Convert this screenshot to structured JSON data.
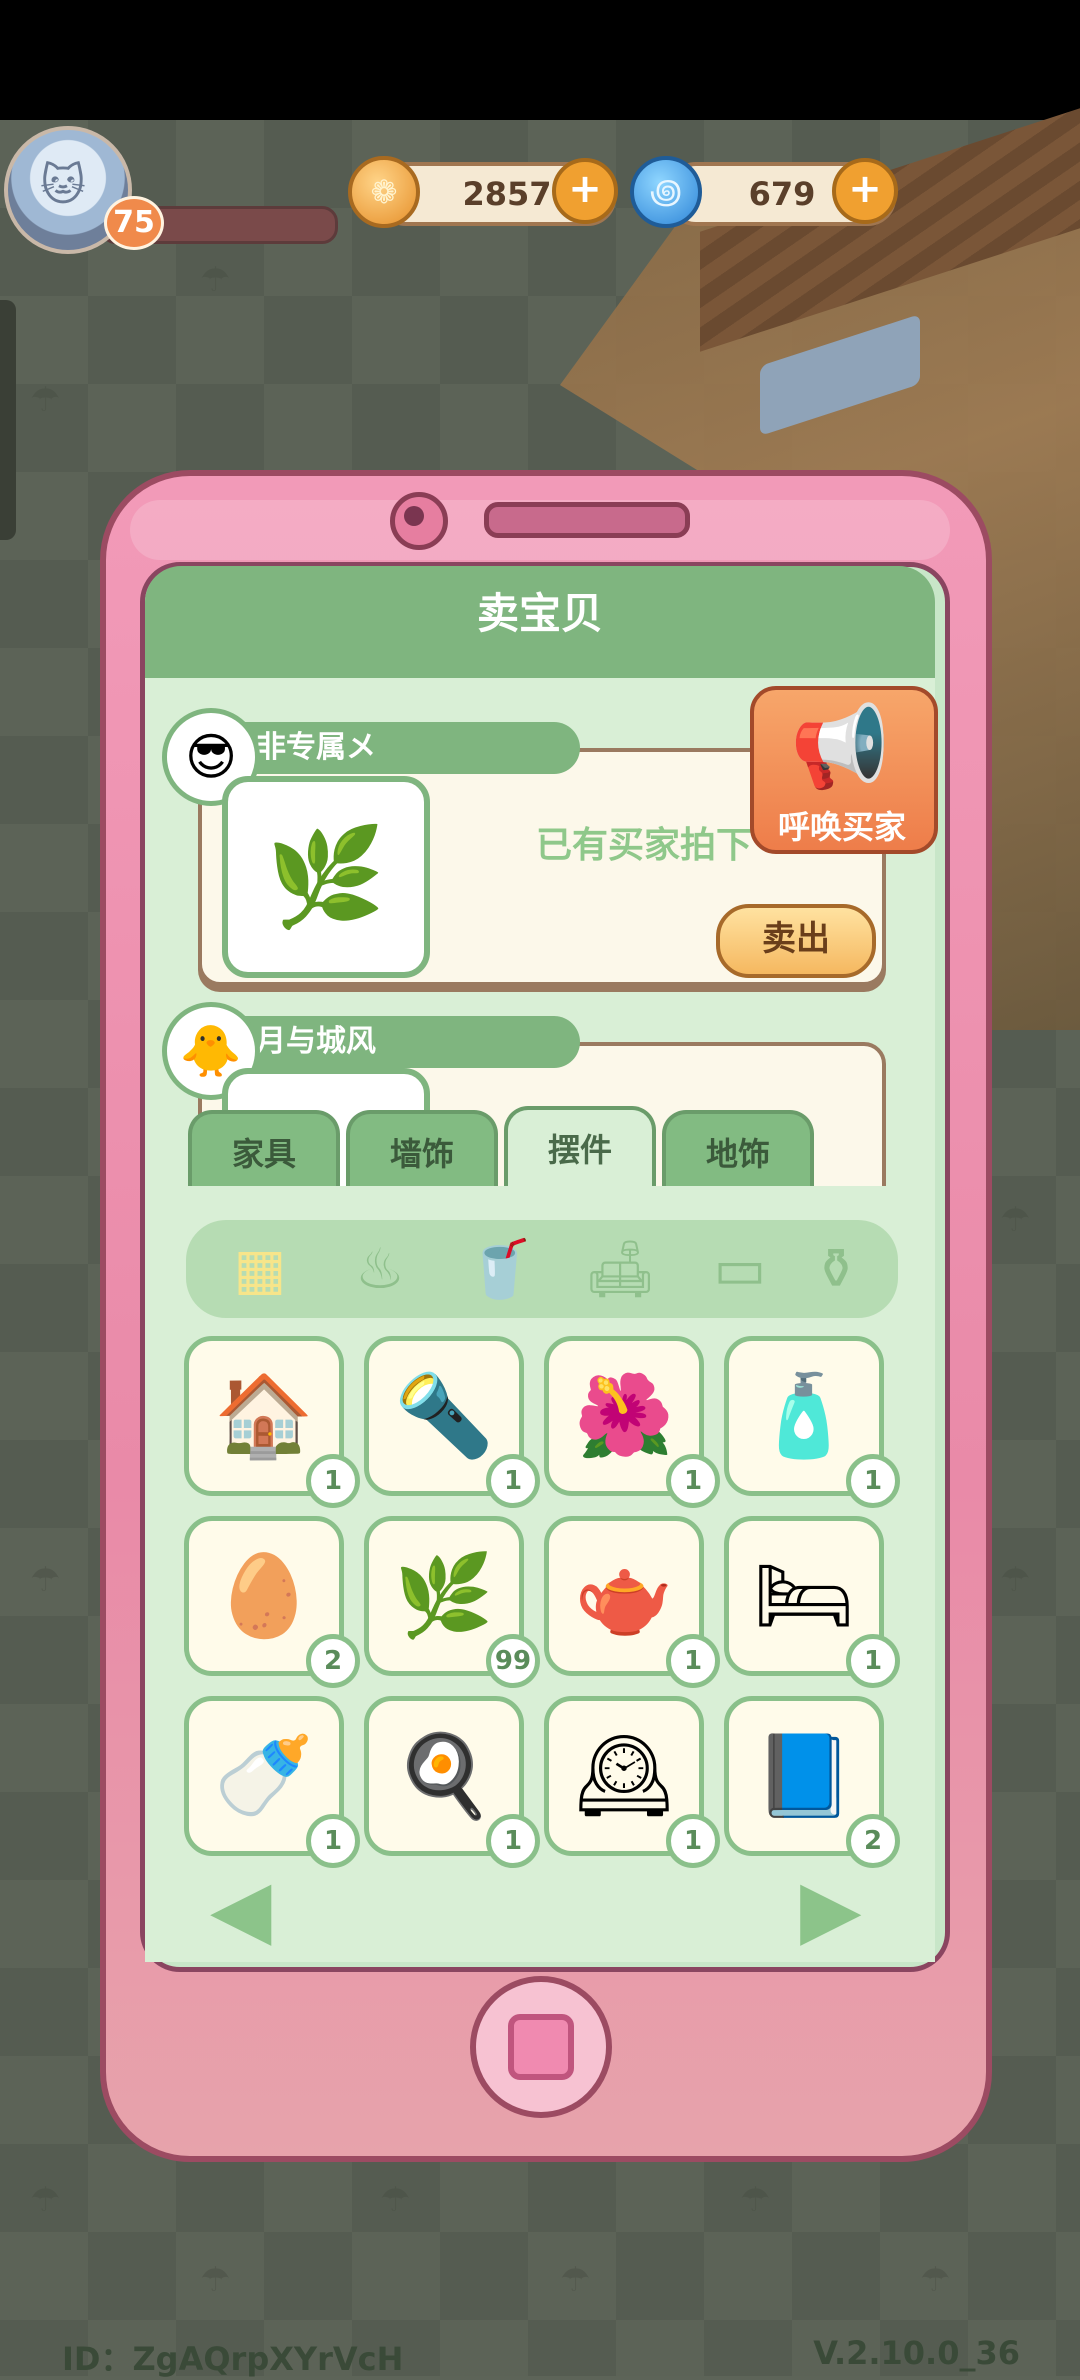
{
  "hud": {
    "level": "75",
    "coins": "2857",
    "gems": "679",
    "plus_label": "+"
  },
  "screen": {
    "title": "卖宝贝",
    "call_buyer_label": "呼唤买家"
  },
  "listings": [
    {
      "seller": "非专属メ",
      "status": "已有买家拍下",
      "sell_label": "卖出",
      "item_icon": "branch-coral-icon"
    },
    {
      "seller": "月与城风",
      "status": "",
      "sell_label": "",
      "item_icon": "branch-coral-icon"
    }
  ],
  "tabs": [
    {
      "label": "家具",
      "active": false
    },
    {
      "label": "墙饰",
      "active": false
    },
    {
      "label": "摆件",
      "active": true
    },
    {
      "label": "地饰",
      "active": false
    }
  ],
  "categories": [
    "grid-icon",
    "pot-icon",
    "cup-icon",
    "lamp-icon",
    "pillow-icon",
    "vase-icon"
  ],
  "inventory": [
    {
      "icon": "dollhouse-icon",
      "glyph": "🏠",
      "count": "1"
    },
    {
      "icon": "flashlight-icon",
      "glyph": "🔦",
      "count": "1"
    },
    {
      "icon": "flower-planter-icon",
      "glyph": "🌺",
      "count": "1"
    },
    {
      "icon": "tube-bottle-icon",
      "glyph": "🧴",
      "count": "1"
    },
    {
      "icon": "egg-icon",
      "glyph": "🥚",
      "count": "2"
    },
    {
      "icon": "branch-coral-icon",
      "glyph": "🌿",
      "count": "99"
    },
    {
      "icon": "tea-set-icon",
      "glyph": "🫖",
      "count": "1"
    },
    {
      "icon": "cushion-icon",
      "glyph": "🛏",
      "count": "1"
    },
    {
      "icon": "soda-bottle-icon",
      "glyph": "🍼",
      "count": "1"
    },
    {
      "icon": "grill-pan-icon",
      "glyph": "🍳",
      "count": "1"
    },
    {
      "icon": "grandfather-clock-icon",
      "glyph": "🕰",
      "count": "1"
    },
    {
      "icon": "book-icon",
      "glyph": "📘",
      "count": "2"
    }
  ],
  "footer": {
    "id": "ID：ZgAQrpXYrVcH",
    "version": "V.2.10.0_36"
  }
}
